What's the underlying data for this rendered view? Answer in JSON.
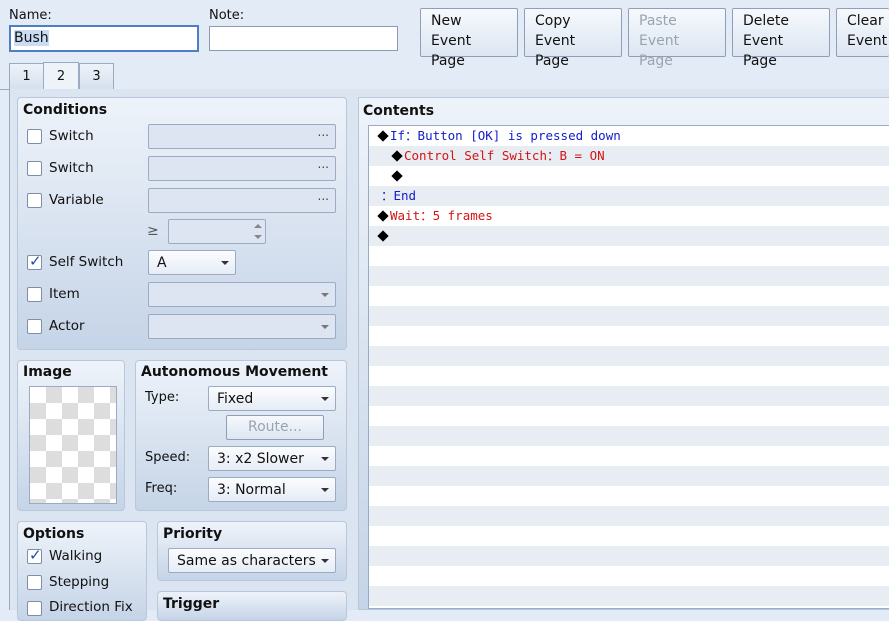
{
  "header": {
    "name_label": "Name:",
    "name_value": "Bush",
    "note_label": "Note:",
    "note_value": ""
  },
  "toolbar": {
    "new_line1": "New",
    "new_line2": "Event Page",
    "copy_line1": "Copy",
    "copy_line2": "Event Page",
    "paste_line1": "Paste",
    "paste_line2": "Event Page",
    "delete_line1": "Delete",
    "delete_line2": "Event Page",
    "clear_line1": "Clear",
    "clear_line2": "Event"
  },
  "tabs": [
    "1",
    "2",
    "3"
  ],
  "active_tab": "2",
  "conditions": {
    "title": "Conditions",
    "switch1_label": "Switch",
    "switch1_checked": false,
    "switch1_value": "",
    "switch2_label": "Switch",
    "switch2_checked": false,
    "switch2_value": "",
    "variable_label": "Variable",
    "variable_checked": false,
    "variable_value": "",
    "ge_symbol": "≥",
    "variable_number": "",
    "self_switch_label": "Self Switch",
    "self_switch_checked": true,
    "self_switch_value": "A",
    "item_label": "Item",
    "item_checked": false,
    "actor_label": "Actor",
    "actor_checked": false,
    "ellipsis": "..."
  },
  "image": {
    "title": "Image"
  },
  "movement": {
    "title": "Autonomous Movement",
    "type_label": "Type:",
    "type_value": "Fixed",
    "route_button": "Route...",
    "speed_label": "Speed:",
    "speed_value": "3: x2 Slower",
    "freq_label": "Freq:",
    "freq_value": "3: Normal"
  },
  "options": {
    "title": "Options",
    "walking_label": "Walking",
    "walking_checked": true,
    "stepping_label": "Stepping",
    "stepping_checked": false,
    "direction_fix_label": "Direction Fix",
    "direction_fix_checked": false
  },
  "priority": {
    "title": "Priority",
    "value": "Same as characters"
  },
  "trigger": {
    "title": "Trigger"
  },
  "contents": {
    "title": "Contents",
    "rows": [
      {
        "indent": 0,
        "marker": "◆",
        "color": "blue",
        "text": "If：Button [OK] is pressed down"
      },
      {
        "indent": 1,
        "marker": "◆",
        "color": "red",
        "text": "Control Self Switch：B = ON"
      },
      {
        "indent": 1,
        "marker": "◆",
        "color": "blue",
        "text": ""
      },
      {
        "indent": 0,
        "marker": "",
        "color": "blue",
        "text": "：End"
      },
      {
        "indent": 0,
        "marker": "◆",
        "color": "red",
        "text": "Wait：5 frames"
      },
      {
        "indent": 0,
        "marker": "◆",
        "color": "blue",
        "text": ""
      }
    ]
  },
  "colors": {
    "command_blue": "#1520c8",
    "command_red": "#d41414",
    "check_blue": "#1d4fa3"
  }
}
